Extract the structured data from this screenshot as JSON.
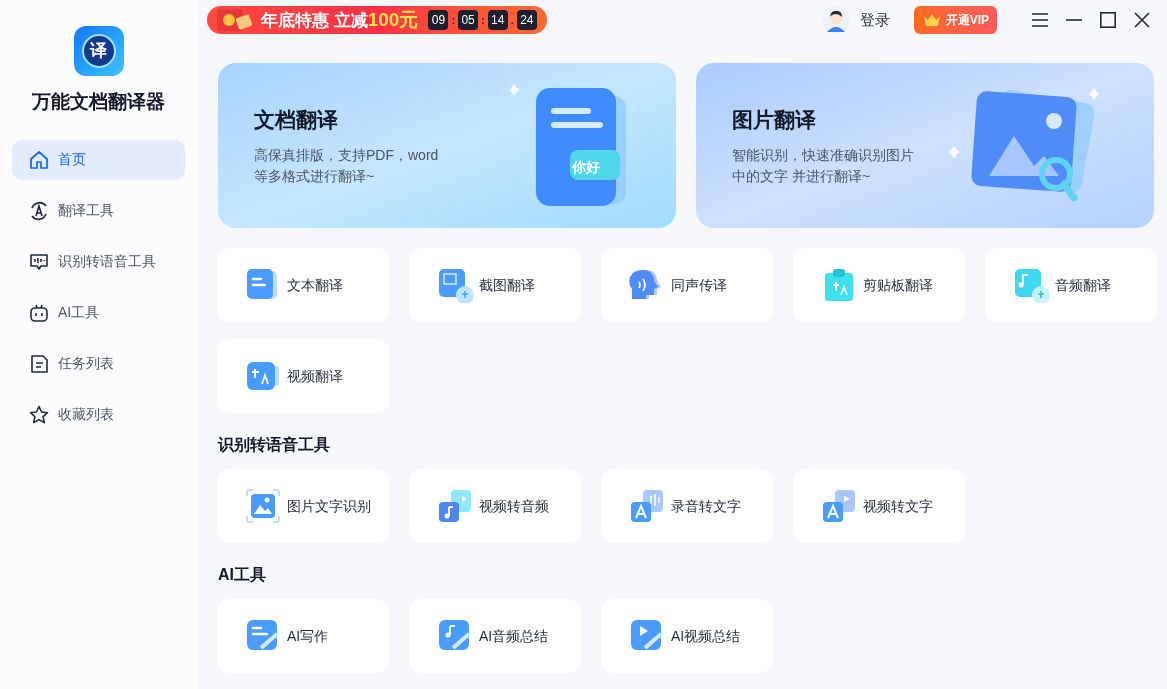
{
  "app": {
    "name": "万能文档翻译器",
    "logo_glyph": "译"
  },
  "sidebar": {
    "items": [
      {
        "label": "首页",
        "kind": "home",
        "selected": true
      },
      {
        "label": "翻译工具",
        "kind": "translate",
        "selected": false
      },
      {
        "label": "识别转语音工具",
        "kind": "voice",
        "selected": false
      },
      {
        "label": "AI工具",
        "kind": "robot",
        "selected": false
      },
      {
        "label": "任务列表",
        "kind": "list",
        "selected": false
      },
      {
        "label": "收藏列表",
        "kind": "star",
        "selected": false
      }
    ]
  },
  "promo": {
    "text": "年底特惠 立减",
    "amount": "100元",
    "countdown": [
      {
        "kind": "digit",
        "text": "09"
      },
      {
        "kind": "sep",
        "text": ":"
      },
      {
        "kind": "digit",
        "text": "05"
      },
      {
        "kind": "sep",
        "text": ":"
      },
      {
        "kind": "digit",
        "text": "14"
      },
      {
        "kind": "sep",
        "text": "."
      },
      {
        "kind": "digit",
        "text": "24"
      }
    ]
  },
  "header": {
    "login": "登录",
    "vip": "开通VIP"
  },
  "hero_cards": [
    {
      "kind": "document",
      "title": "文档翻译",
      "desc_lines": [
        "高保真排版，支持PDF，word",
        "等多格式进行翻译~"
      ],
      "badge": "你好"
    },
    {
      "kind": "image",
      "title": "图片翻译",
      "desc_lines": [
        "智能识别，快速准确识别图片",
        "中的文字 并进行翻译~"
      ]
    }
  ],
  "sections": [
    {
      "tools": [
        {
          "label": "文本翻译",
          "kind": "text"
        },
        {
          "label": "截图翻译",
          "kind": "screenshot"
        },
        {
          "label": "同声传译",
          "kind": "head"
        },
        {
          "label": "剪贴板翻译",
          "kind": "clipboard"
        },
        {
          "label": "音频翻译",
          "kind": "music"
        },
        {
          "label": "视频翻译",
          "kind": "video"
        }
      ]
    },
    {
      "title": "识别转语音工具",
      "tools": [
        {
          "label": "图片文字识别",
          "kind": "picture"
        },
        {
          "label": "视频转音频",
          "kind": "video-audio"
        },
        {
          "label": "录音转文字",
          "kind": "audio-text"
        },
        {
          "label": "视频转文字",
          "kind": "video-text"
        }
      ]
    },
    {
      "title": "AI工具",
      "tools": [
        {
          "label": "AI写作",
          "kind": "ai-write"
        },
        {
          "label": "AI音频总结",
          "kind": "ai-audio"
        },
        {
          "label": "AI视频总结",
          "kind": "ai-video"
        }
      ]
    }
  ]
}
